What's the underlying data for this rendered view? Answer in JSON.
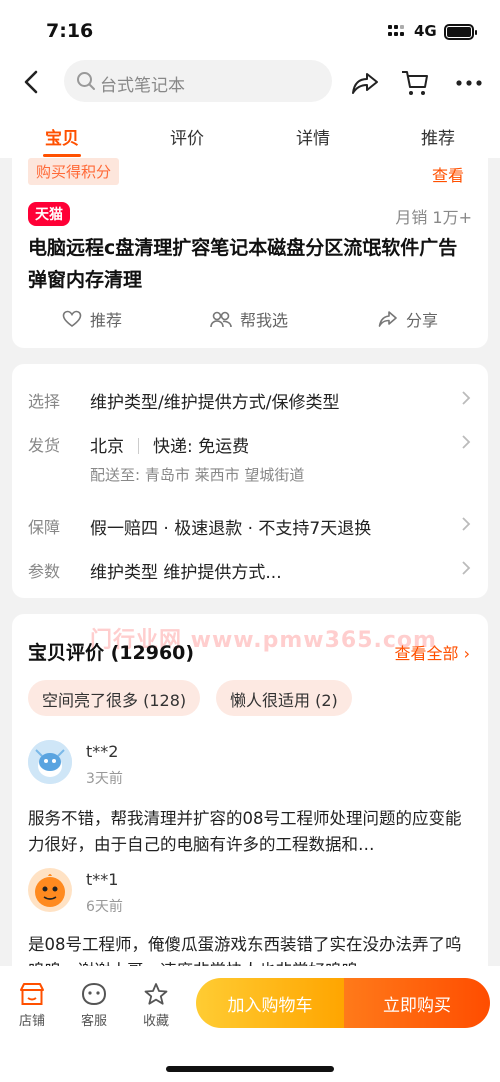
{
  "status_bar": {
    "time": "7:16",
    "network": "4G"
  },
  "header": {
    "search_placeholder": "台式笔记本"
  },
  "tabs": [
    {
      "label": "宝贝",
      "active": true
    },
    {
      "label": "评价",
      "active": false
    },
    {
      "label": "详情",
      "active": false
    },
    {
      "label": "推荐",
      "active": false
    }
  ],
  "product": {
    "points_tag": "购买得积分",
    "view_link": "查看",
    "store_badge": "天猫",
    "sales": "月销 1万+",
    "title": "电脑远程c盘清理扩容笔记本磁盘分区流氓软件广告弹窗内存清理",
    "actions": {
      "recommend": "推荐",
      "help_choose": "帮我选",
      "share": "分享"
    }
  },
  "specs": {
    "select": {
      "key": "选择",
      "value": "维护类型/维护提供方式/保修类型"
    },
    "shipping": {
      "key": "发货",
      "origin": "北京",
      "delivery": "快递: 免运费",
      "destination": "配送至: 青岛市 莱西市 望城街道"
    },
    "guarantee": {
      "key": "保障",
      "value": "假一赔四 · 极速退款 · 不支持7天退换"
    },
    "params": {
      "key": "参数",
      "value": "维护类型 维护提供方式..."
    }
  },
  "reviews": {
    "title": "宝贝评价 (12960)",
    "view_all": "查看全部",
    "watermark": "门行业网 www.pmw365.com",
    "tags": [
      "空间亮了很多 (128)",
      "懒人很适用 (2)"
    ],
    "items": [
      {
        "user": "t**2",
        "time": "3天前",
        "text": "服务不错，帮我清理并扩容的08号工程师处理问题的应变能力很好，由于自己的电脑有许多的工程数据和…"
      },
      {
        "user": "t**1",
        "time": "6天前",
        "text": "是08号工程师，俺傻瓜蛋游戏东西装错了实在没办法弄了呜呜呜，谢谢小哥。速度非常快人也非常好呜呜…"
      }
    ]
  },
  "bottom_bar": {
    "shop": "店铺",
    "service": "客服",
    "favorite": "收藏",
    "add_to_cart": "加入购物车",
    "buy_now": "立即购买"
  },
  "colors": {
    "accent": "#ff5000",
    "tmall_red": "#ff0036",
    "cart_yellow": "#ffb300"
  }
}
